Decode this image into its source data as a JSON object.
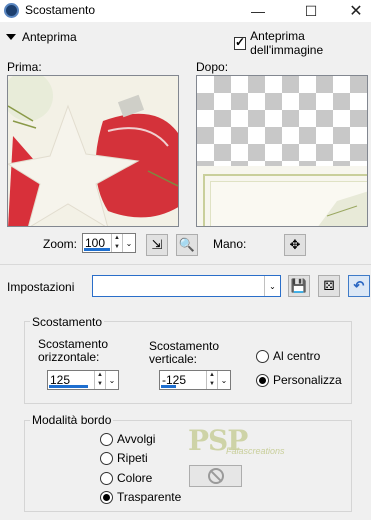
{
  "window": {
    "title": "Scostamento"
  },
  "preview": {
    "toggle_label": "Anteprima",
    "image_preview_label": "Anteprima dell'immagine",
    "image_preview_checked": true,
    "before_label": "Prima:",
    "after_label": "Dopo:"
  },
  "zoom": {
    "label": "Zoom:",
    "value": "100",
    "pan_label": "Mano:"
  },
  "presets": {
    "label": "Impostazioni",
    "value": ""
  },
  "offset": {
    "group_title": "Scostamento",
    "horizontal_label_1": "Scostamento",
    "horizontal_label_2": "orizzontale:",
    "horizontal_value": "125",
    "vertical_label_1": "Scostamento",
    "vertical_label_2": "verticale:",
    "vertical_value": "-125",
    "center_label": "Al centro",
    "custom_label": "Personalizza",
    "selected": "custom"
  },
  "edge_mode": {
    "group_title": "Modalità bordo",
    "options": [
      "Avvolgi",
      "Ripeti",
      "Colore",
      "Trasparente"
    ],
    "selected": "Trasparente"
  },
  "watermark": {
    "main": "PSP",
    "sub": "Falascreations"
  },
  "colors": {
    "accent": "#1e6fd0",
    "window_bg": "#f0f0f0"
  },
  "icons": [
    "app-icon",
    "minimize-icon",
    "maximize-icon",
    "close-icon",
    "fit-window-icon",
    "zoom-actual-icon",
    "pan-icon",
    "save-preset-icon",
    "randomize-icon",
    "reset-icon",
    "no-color-icon"
  ]
}
